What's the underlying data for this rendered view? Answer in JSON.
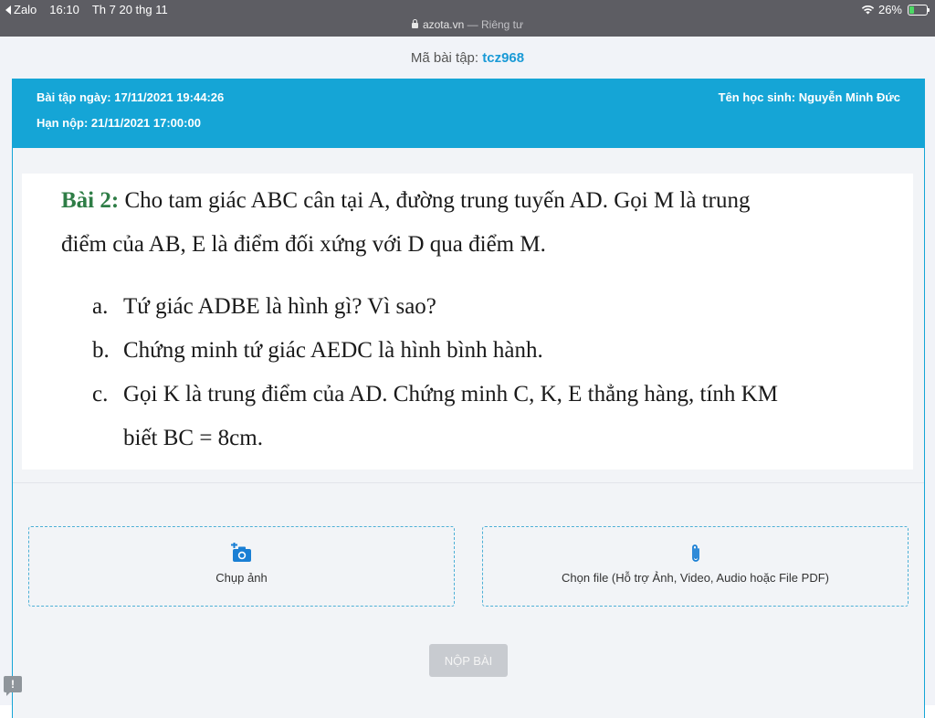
{
  "statusbar": {
    "back_app": "Zalo",
    "time": "16:10",
    "date": "Th 7 20 thg 11",
    "domain": "azota.vn",
    "privacy": "— Riêng tư",
    "battery": "26%",
    "battery_level": 0.26
  },
  "exercise": {
    "code_label": "Mã bài tập:",
    "code": "tcz968"
  },
  "header": {
    "assigned": "Bài tập ngày: 17/11/2021 19:44:26",
    "deadline": "Hạn nộp: 21/11/2021 17:00:00",
    "student": "Tên học sinh: Nguyễn Minh Đức"
  },
  "question": {
    "label": "Bài 2:",
    "line1": "Cho tam giác ABC cân tại A, đường trung tuyến AD. Gọi M là trung",
    "line2": "điểm của AB, E là điểm đối xứng với D qua điểm M.",
    "items": [
      {
        "marker": "a.",
        "text": "Tứ giác ADBE là hình gì? Vì sao?"
      },
      {
        "marker": "b.",
        "text": "Chứng minh tứ giác AEDC là hình bình hành."
      },
      {
        "marker": "c.",
        "text": "Gọi K là trung điểm của AD. Chứng minh C, K, E thẳng hàng, tính KM"
      }
    ],
    "item_c_cont": "biết BC = 8cm."
  },
  "upload": {
    "camera_label": "Chụp ảnh",
    "file_label": "Chọn file (Hỗ trợ Ảnh, Video, Audio hoặc File PDF)"
  },
  "submit_label": "NỘP BÀI",
  "icons": {
    "camera": "add-photo-icon",
    "file": "paperclip-icon",
    "feedback": "feedback-icon"
  },
  "colors": {
    "accent": "#15a5d6",
    "label_green": "#2e7d46",
    "submit_disabled": "#c8cbd0"
  }
}
